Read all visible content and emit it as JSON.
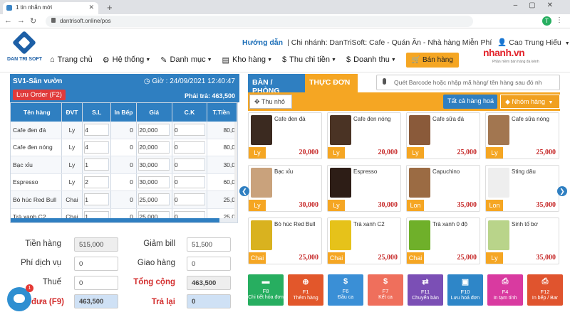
{
  "browser": {
    "tab_title": "1 tin nhắn mới",
    "url": "dantrisoft.online/pos",
    "avatar_letter": "T"
  },
  "header": {
    "logo_text": "DAN TRI SOFT",
    "guide": "Hướng dẫn",
    "branch": "| Chi nhánh: DanTriSoft: Cafe - Quán Ăn - Nhà hàng Miễn Phí",
    "user": "Cao Trung Hiếu",
    "brand": "nhanh.vn",
    "brand_sub": "Phần mềm bán hàng đa kênh",
    "nav": [
      {
        "label": "Trang chủ",
        "icon": "home-icon"
      },
      {
        "label": "Hệ thống",
        "icon": "gear-icon"
      },
      {
        "label": "Danh mục",
        "icon": "wrench-icon"
      },
      {
        "label": "Kho hàng",
        "icon": "warehouse-icon"
      },
      {
        "label": "Thu chi tiền",
        "icon": "dollar-icon"
      },
      {
        "label": "Doanh thu",
        "icon": "dollar-icon"
      }
    ],
    "sale_button": "Bán hàng"
  },
  "order": {
    "table_name": "SV1-Sân vườn",
    "time": "Giờ : 24/09/2021 12:40:47",
    "save_button": "Lưu Order (F2)",
    "to_pay": "Phải trả: 463,500",
    "columns": [
      "Tên hàng",
      "ĐVT",
      "S.L",
      "In Bếp",
      "Giá",
      "C.K",
      "T.Tiền"
    ],
    "rows": [
      {
        "name": "Cafe đen đá",
        "unit": "Ly",
        "qty": "4",
        "kitchen": "0",
        "price": "20,000",
        "ck": "0",
        "total": "80,0"
      },
      {
        "name": "Cafe đen nóng",
        "unit": "Ly",
        "qty": "4",
        "kitchen": "0",
        "price": "20,000",
        "ck": "0",
        "total": "80,0"
      },
      {
        "name": "Bạc xỉu",
        "unit": "Ly",
        "qty": "1",
        "kitchen": "0",
        "price": "30,000",
        "ck": "0",
        "total": "30,0"
      },
      {
        "name": "Espresso",
        "unit": "Ly",
        "qty": "2",
        "kitchen": "0",
        "price": "30,000",
        "ck": "0",
        "total": "60,0"
      },
      {
        "name": "Bò húc Red Bull",
        "unit": "Chai",
        "qty": "1",
        "kitchen": "0",
        "price": "25,000",
        "ck": "0",
        "total": "25,0"
      },
      {
        "name": "Trà xanh C2",
        "unit": "Chai",
        "qty": "1",
        "kitchen": "0",
        "price": "25,000",
        "ck": "0",
        "total": "25,0"
      }
    ]
  },
  "totals": {
    "tien_hang_label": "Tiền hàng",
    "tien_hang": "515,000",
    "phi_dv_label": "Phí dịch vụ",
    "phi_dv": "0",
    "thue_label": "Thuế",
    "thue": "0",
    "khach_dua_label": "đưa (F9)",
    "khach_dua": "463,500",
    "giam_bill_label": "Giảm bill",
    "giam_bill": "51,500",
    "giao_hang_label": "Giao hàng",
    "giao_hang": "0",
    "tong_cong_label": "Tổng cộng",
    "tong_cong": "463,500",
    "tra_lai_label": "Trả lại",
    "tra_lai": "0",
    "chat_badge": "1"
  },
  "menu": {
    "tab_tables": "BÀN / PHÒNG",
    "tab_menu": "THỰC ĐƠN",
    "barcode_placeholder": "Quét Barcode hoặc nhập mã hàng/ tên hàng sau đó nh",
    "shrink_button": "Thu nhỏ",
    "all_button": "Tất cả hàng hoá",
    "group_button": "Nhóm hàng",
    "products": [
      {
        "name": "Cafe đen đá",
        "unit": "Ly",
        "price": "20,000",
        "color": "#3b2a20"
      },
      {
        "name": "Cafe đen nóng",
        "unit": "Ly",
        "price": "20,000",
        "color": "#4a3324"
      },
      {
        "name": "Cafe sữa đá",
        "unit": "Ly",
        "price": "25,000",
        "color": "#8a5a3a"
      },
      {
        "name": "Cafe sữa nóng",
        "unit": "Ly",
        "price": "25,000",
        "color": "#a27650"
      },
      {
        "name": "Bạc xỉu",
        "unit": "Ly",
        "price": "30,000",
        "color": "#c9a27c"
      },
      {
        "name": "Espresso",
        "unit": "Ly",
        "price": "30,000",
        "color": "#2d1d16"
      },
      {
        "name": "Capuchino",
        "unit": "Lon",
        "price": "35,000",
        "color": "#9b6b43"
      },
      {
        "name": "Sting dâu",
        "unit": "Lon",
        "price": "35,000",
        "color": "#eeeeee"
      },
      {
        "name": "Bò húc Red Bull",
        "unit": "Chai",
        "price": "25,000",
        "color": "#d9b21f"
      },
      {
        "name": "Trà xanh C2",
        "unit": "Chai",
        "price": "25,000",
        "color": "#e6c21a"
      },
      {
        "name": "Trà xanh 0 độ",
        "unit": "Chai",
        "price": "25,000",
        "color": "#6fb02a"
      },
      {
        "name": "Sinh tố bơ",
        "unit": "Ly",
        "price": "35,000",
        "color": "#b9d48a"
      }
    ]
  },
  "fkeys": [
    {
      "key": "F8",
      "label": "Chi tiết hóa đơn",
      "icon": "folder-icon",
      "color": "#27ae60",
      "glyph": "▬"
    },
    {
      "key": "F1",
      "label": "Thêm hàng",
      "icon": "plus-icon",
      "color": "#e2572b",
      "glyph": "⊕"
    },
    {
      "key": "F6",
      "label": "Đầu ca",
      "icon": "dollar-icon",
      "color": "#3a8fd6",
      "glyph": "$"
    },
    {
      "key": "F7",
      "label": "Kết ca",
      "icon": "dollar-icon",
      "color": "#ef6f5c",
      "glyph": "$"
    },
    {
      "key": "F11",
      "label": "Chuyển bàn",
      "icon": "transfer-icon",
      "color": "#7b4fb5",
      "glyph": "⇄"
    },
    {
      "key": "F10",
      "label": "Lưu hoá đơn",
      "icon": "save-icon",
      "color": "#2e86c8",
      "glyph": "▣"
    },
    {
      "key": "F4",
      "label": "In tạm tính",
      "icon": "print-icon",
      "color": "#d93aa0",
      "glyph": "⎙"
    },
    {
      "key": "F12",
      "label": "In bếp / Bar",
      "icon": "print-icon",
      "color": "#e0542e",
      "glyph": "⎙"
    }
  ]
}
